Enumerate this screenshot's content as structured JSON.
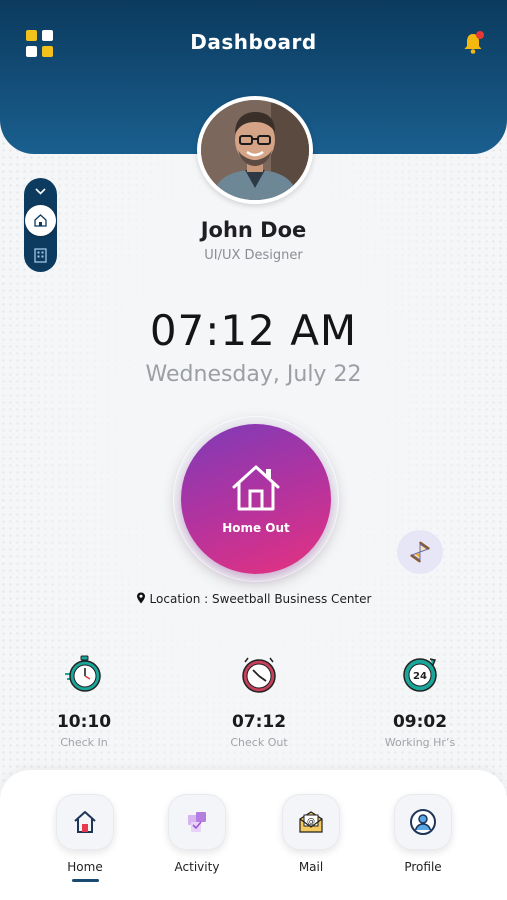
{
  "header": {
    "title": "Dashboard",
    "menu_icon": "grid-icon",
    "notification_icon": "bell-icon",
    "notification_dot_color": "#e53935",
    "accent": "#0b3a5e"
  },
  "profile": {
    "name": "John Doe",
    "role": "UI/UX Designer"
  },
  "side_toggle": {
    "icons": [
      "chevron-down-icon",
      "home-icon",
      "building-icon"
    ]
  },
  "clock": {
    "time": "07:12 AM",
    "date": "Wednesday, July 22"
  },
  "action": {
    "label": "Home Out",
    "icon": "house-icon",
    "gradient": [
      "#7e3bb8",
      "#e6327f"
    ]
  },
  "location": {
    "text": "Location : Sweetball Business Center"
  },
  "stats": [
    {
      "value": "10:10",
      "label": "Check In",
      "icon": "stopwatch-icon"
    },
    {
      "value": "07:12",
      "label": "Check Out",
      "icon": "clock-icon"
    },
    {
      "value": "09:02",
      "label": "Working Hr’s",
      "icon": "24-hours-icon"
    }
  ],
  "nav": {
    "items": [
      {
        "label": "Home",
        "icon": "home-icon"
      },
      {
        "label": "Activity",
        "icon": "activity-icon"
      },
      {
        "label": "Mail",
        "icon": "mail-icon"
      },
      {
        "label": "Profile",
        "icon": "profile-icon"
      }
    ],
    "active_index": 0
  }
}
